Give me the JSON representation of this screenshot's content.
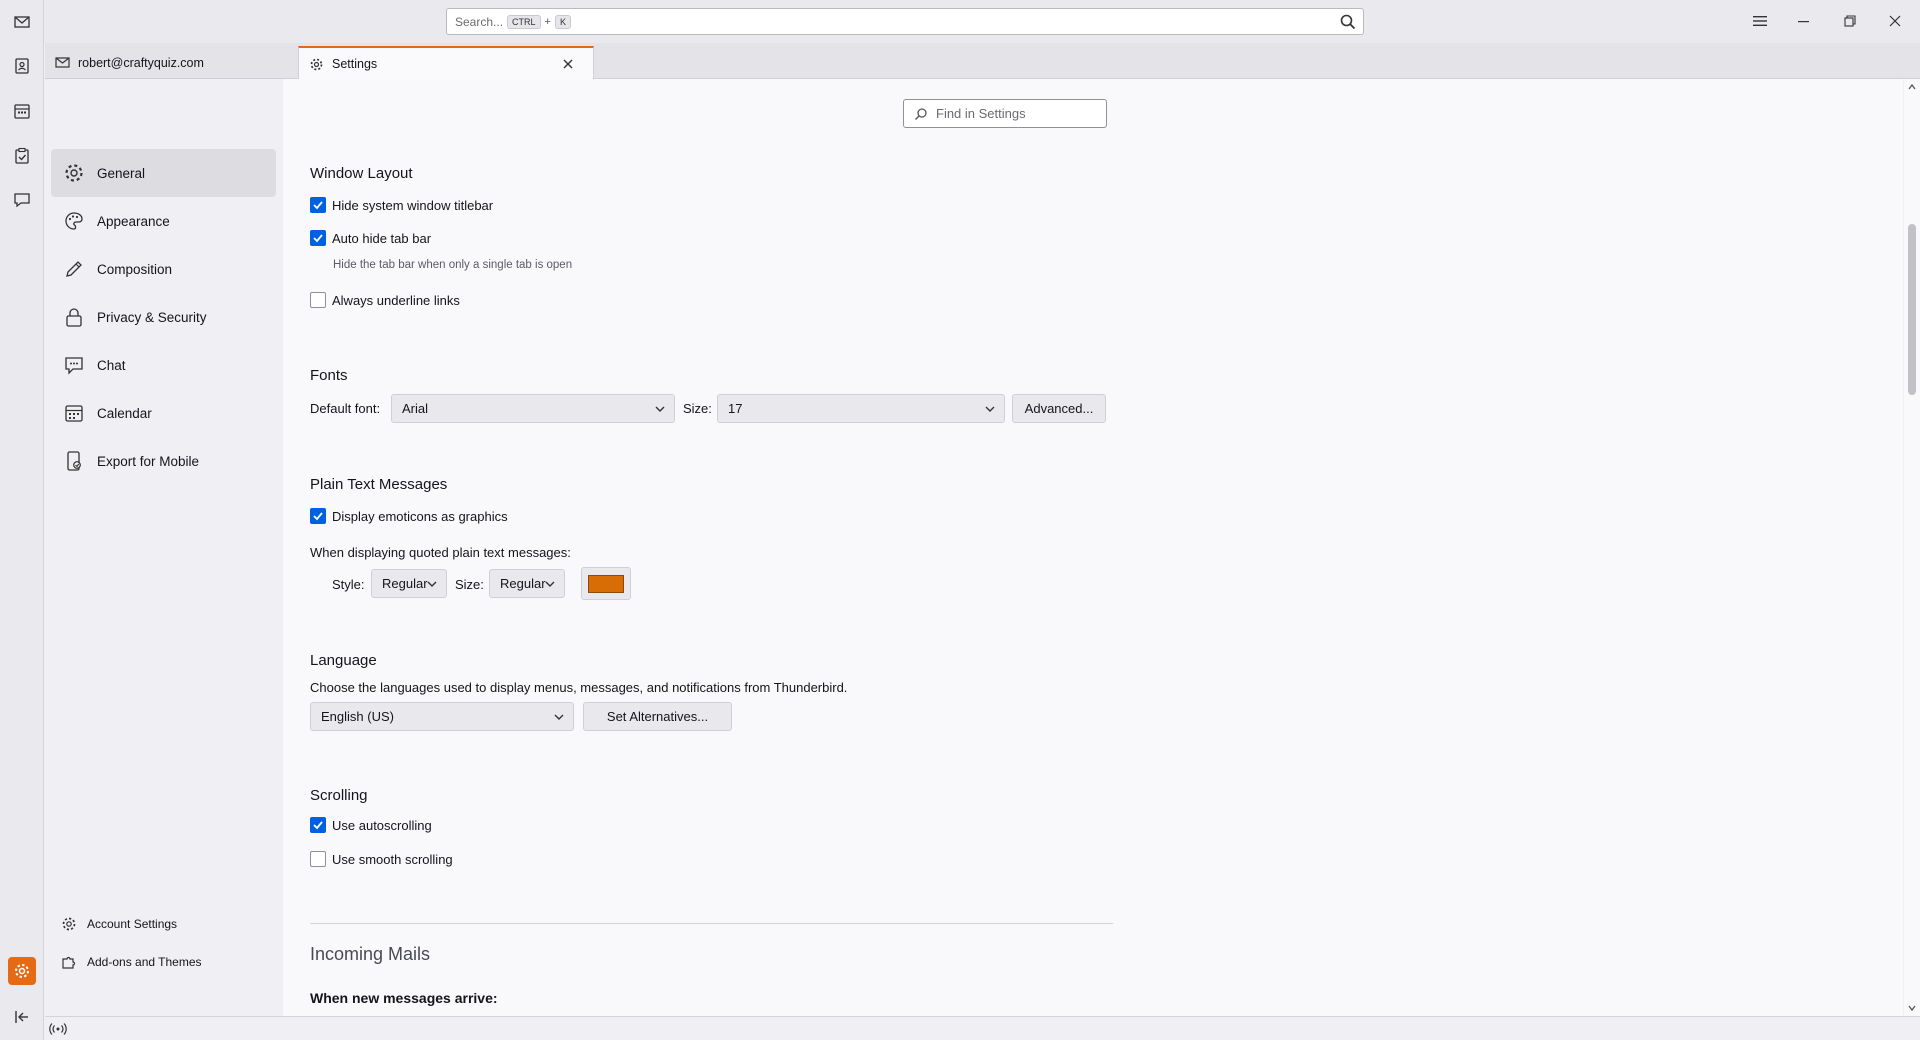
{
  "search": {
    "placeholder": "Search...",
    "key1": "CTRL",
    "plus": "+",
    "key2": "K"
  },
  "tabs": {
    "mail": {
      "label": "robert@craftyquiz.com"
    },
    "settings": {
      "label": "Settings"
    }
  },
  "sidebar": {
    "categories": [
      {
        "label": "General",
        "icon": "gear-icon"
      },
      {
        "label": "Appearance",
        "icon": "palette-icon"
      },
      {
        "label": "Composition",
        "icon": "pencil-icon"
      },
      {
        "label": "Privacy & Security",
        "icon": "lock-icon"
      },
      {
        "label": "Chat",
        "icon": "chat-icon"
      },
      {
        "label": "Calendar",
        "icon": "calendar-icon"
      },
      {
        "label": "Export for Mobile",
        "icon": "mobile-export-icon"
      }
    ],
    "bottom": {
      "account_settings": "Account Settings",
      "addons": "Add-ons and Themes"
    }
  },
  "find": {
    "placeholder": "Find in Settings"
  },
  "window_layout": {
    "title": "Window Layout",
    "hide_titlebar": "Hide system window titlebar",
    "auto_hide_tabbar": "Auto hide tab bar",
    "auto_hide_hint": "Hide the tab bar when only a single tab is open",
    "underline_links": "Always underline links"
  },
  "fonts": {
    "title": "Fonts",
    "default_font_label": "Default font:",
    "default_font_value": "Arial",
    "size_label": "Size:",
    "size_value": "17",
    "advanced": "Advanced..."
  },
  "plain_text": {
    "title": "Plain Text Messages",
    "emoticons": "Display emoticons as graphics",
    "quoted_label": "When displaying quoted plain text messages:",
    "style_label": "Style:",
    "style_value": "Regular",
    "size_label": "Size:",
    "size_value": "Regular",
    "color": "#d86c05"
  },
  "language": {
    "title": "Language",
    "description": "Choose the languages used to display menus, messages, and notifications from Thunderbird.",
    "value": "English (US)",
    "alternatives": "Set Alternatives..."
  },
  "scrolling": {
    "title": "Scrolling",
    "autoscroll": "Use autoscrolling",
    "smooth": "Use smooth scrolling"
  },
  "incoming": {
    "title": "Incoming Mails",
    "subhead": "When new messages arrive:"
  },
  "colors": {
    "accent": "#e66a14",
    "checkbox": "#0061e0"
  }
}
